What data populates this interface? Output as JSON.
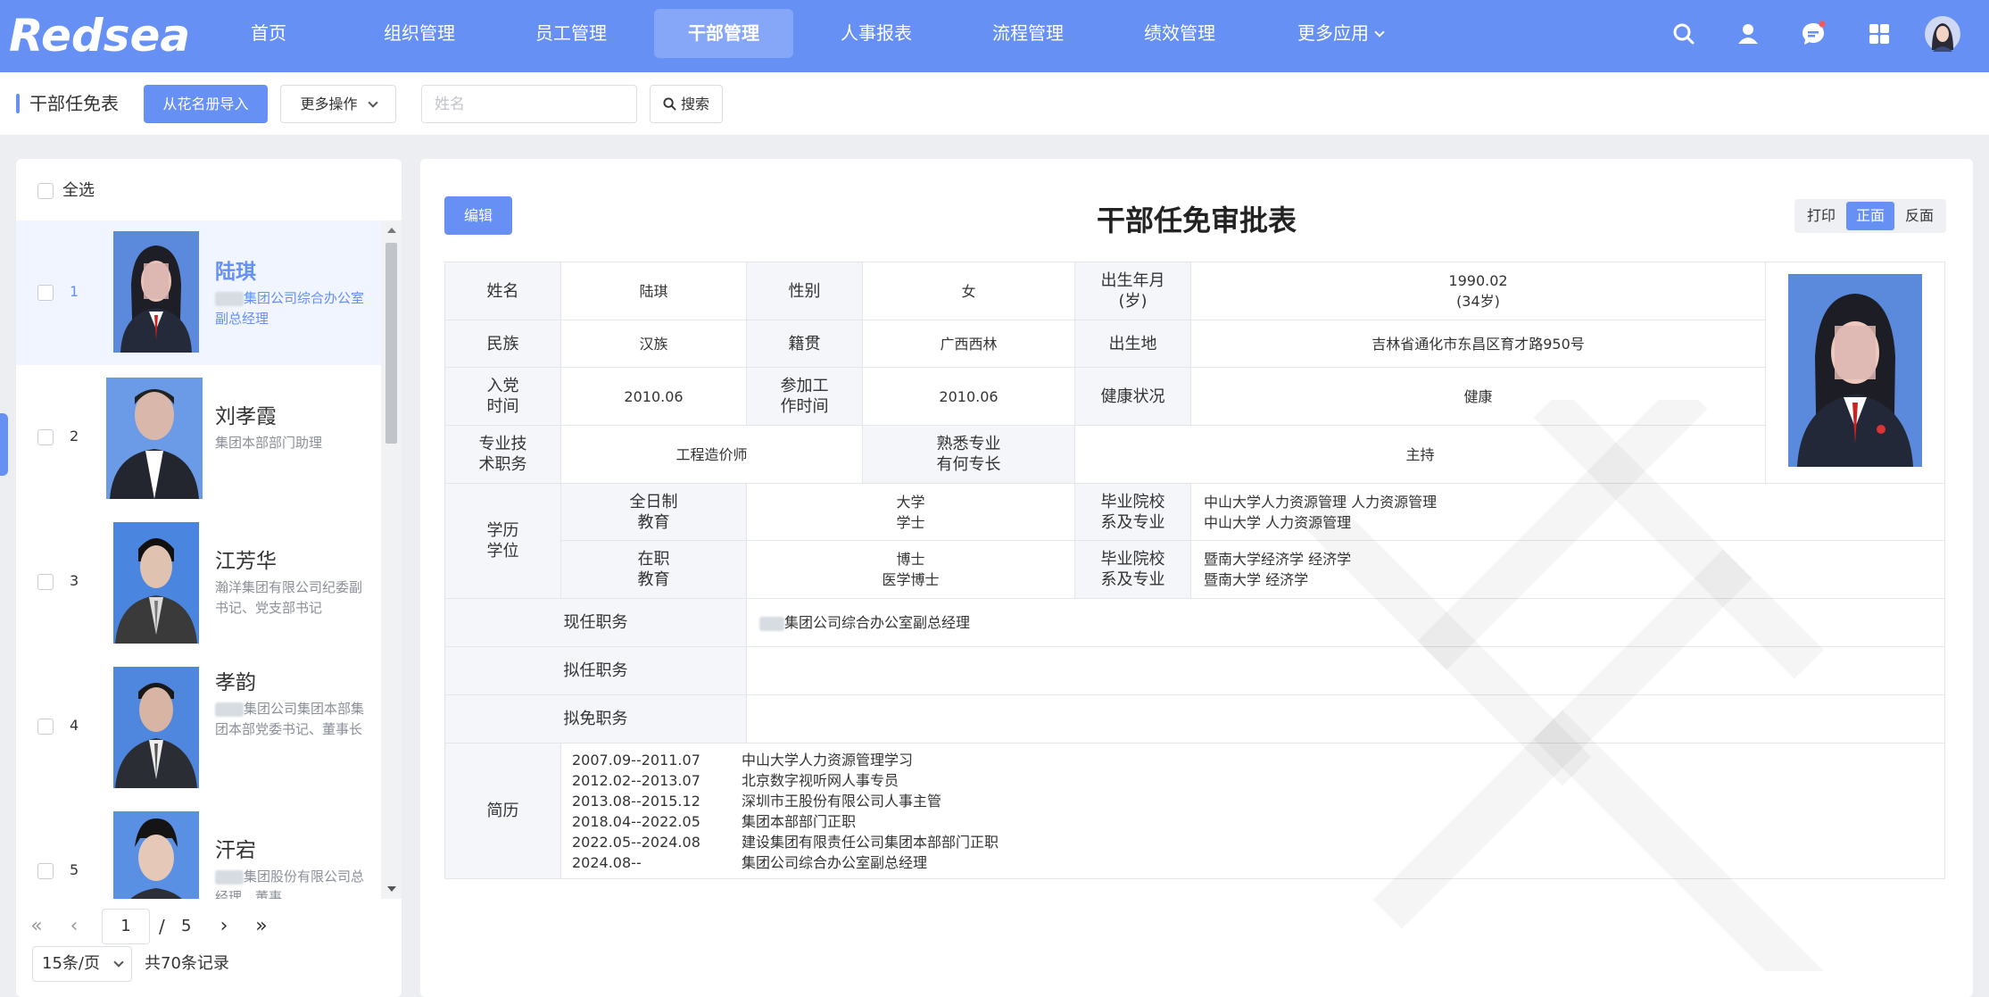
{
  "brand": {
    "logo_text": "Redsea",
    "accent_color": "#6690f4"
  },
  "nav": {
    "items": [
      {
        "label": "首页"
      },
      {
        "label": "组织管理"
      },
      {
        "label": "员工管理"
      },
      {
        "label": "干部管理"
      },
      {
        "label": "人事报表"
      },
      {
        "label": "流程管理"
      },
      {
        "label": "绩效管理"
      },
      {
        "label": "更多应用"
      }
    ],
    "active": "干部管理",
    "icons": [
      "search-icon",
      "user-icon",
      "message-icon",
      "apps-grid-icon",
      "avatar"
    ]
  },
  "toolbar": {
    "title": "干部任免表",
    "import_label": "从花名册导入",
    "more_label": "更多操作",
    "name_placeholder": "姓名",
    "search_label": "搜索"
  },
  "list": {
    "select_all": "全选",
    "items": [
      {
        "index": "1",
        "name": "陆琪",
        "desc": "集团公司综合办公室副总经理"
      },
      {
        "index": "2",
        "name": "刘孝霞",
        "desc": "集团本部部门助理"
      },
      {
        "index": "3",
        "name": "江芳华",
        "desc": "瀚洋集团有限公司纪委副书记、党支部书记"
      },
      {
        "index": "4",
        "name": "孝韵",
        "desc": "集团公司集团本部集团本部党委书记、董事长"
      },
      {
        "index": "5",
        "name": "汗宕",
        "desc": "集团股份有限公司总经理、董事"
      }
    ],
    "pager": {
      "current": "1",
      "separator": "/",
      "total_pages": "5",
      "page_size": "15条/页",
      "total_text": "共70条记录"
    }
  },
  "form": {
    "edit_label": "编辑",
    "title": "干部任免审批表",
    "modes": [
      "打印",
      "正面",
      "反面"
    ],
    "active_mode": "正面",
    "labels": {
      "name": "姓名",
      "gender": "性别",
      "birth": "出生年月\n(岁)",
      "ethnicity": "民族",
      "native": "籍贯",
      "birthplace": "出生地",
      "party": "入党\n时间",
      "work_start": "参加工\n作时间",
      "health": "健康状况",
      "title": "专业技\n术职务",
      "specialty": "熟悉专业\n有何专长",
      "education": "学历\n学位",
      "fulltime": "全日制\n教育",
      "inservice": "在职\n教育",
      "school": "毕业院校\n系及专业",
      "current": "现任职务",
      "proposed": "拟任职务",
      "removed": "拟免职务",
      "resume": "简历"
    },
    "values": {
      "name": "陆琪",
      "gender": "女",
      "birth": "1990.02\n(34岁)",
      "ethnicity": "汉族",
      "native": "广西西林",
      "birthplace": "吉林省通化市东昌区育才路950号",
      "party": "2010.06",
      "work_start": "2010.06",
      "health": "健康",
      "title": "工程造价师",
      "specialty": "主持",
      "fulltime_degree": "大学\n学士",
      "fulltime_school": "中山大学人力资源管理 人力资源管理\n中山大学 人力资源管理",
      "inservice_degree": "博士\n医学博士",
      "inservice_school": "暨南大学经济学 经济学\n暨南大学 经济学",
      "current": "集团公司综合办公室副总经理",
      "proposed": "",
      "removed": ""
    },
    "resume": [
      {
        "date": "2007.09--2011.07",
        "text": "中山大学人力资源管理学习"
      },
      {
        "date": "2012.02--2013.07",
        "text": "北京数字视听网人事专员"
      },
      {
        "date": "2013.08--2015.12",
        "text": "深圳市王股份有限公司人事主管"
      },
      {
        "date": "2018.04--2022.05",
        "text": "集团本部部门正职"
      },
      {
        "date": "2022.05--2024.08",
        "text": "建设集团有限责任公司集团本部部门正职"
      },
      {
        "date": "2024.08--",
        "text": "集团公司综合办公室副总经理"
      }
    ]
  }
}
